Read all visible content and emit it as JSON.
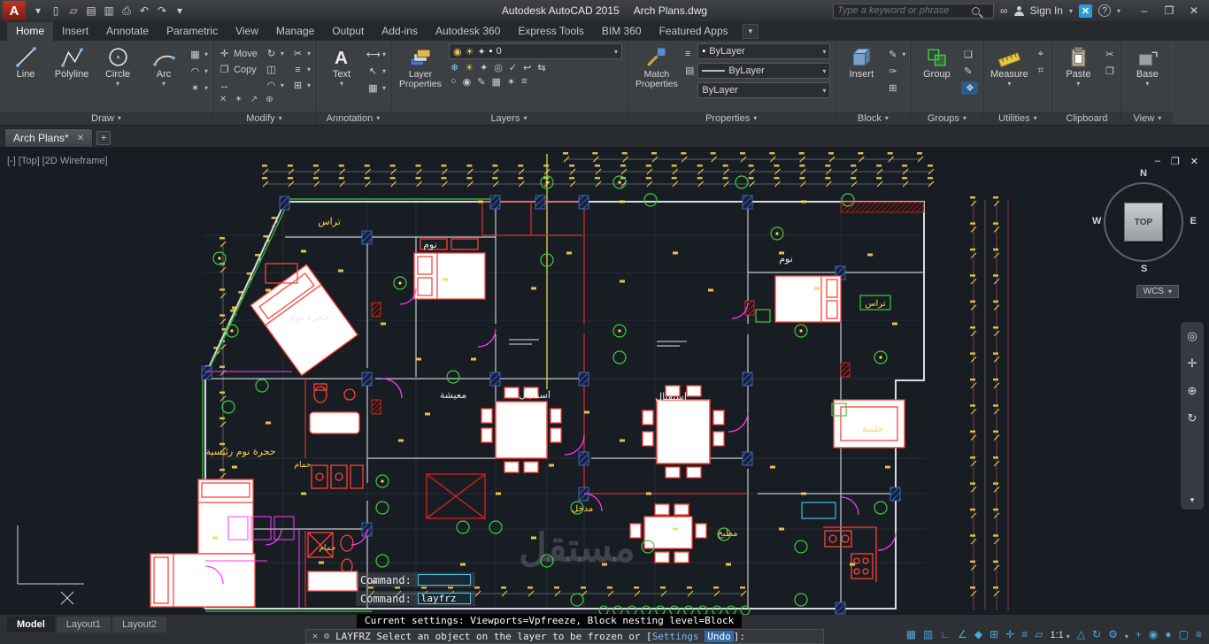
{
  "colors": {
    "background": "#181d23",
    "wall": "#d8dce0",
    "furniture_red": "#ff4038",
    "dimension_yellow": "#ffd34d",
    "door_magenta": "#ff3bff",
    "grid_green": "#3ecb3e",
    "hatch_blue": "#4f74d8",
    "status_teal": "#4aa8dc",
    "logo_red": "#b42a22"
  },
  "icons": {
    "logo_a": "A",
    "text_a": "A",
    "new": "▯",
    "open": "▱",
    "save": "▤",
    "saveas": "▥",
    "plot": "⎙",
    "undo": "↶",
    "redo": "↷",
    "caret": "▾",
    "binoculars": "∞",
    "star": "★",
    "exchange": "✕",
    "help": "?",
    "minimize": "–",
    "maximize": "❐",
    "close": "✕",
    "plus": "+",
    "rotate": "↻",
    "mirror": "◫",
    "fillet": "◠",
    "trim": "✂",
    "offset": "≡",
    "array": "⊞",
    "erase": "✕",
    "explode": "✶",
    "stretch": "↔",
    "scale": "↗",
    "join": "⊕",
    "dim": "⟷",
    "leader": "↖",
    "table": "▦",
    "freeze": "❄",
    "sun": "☀",
    "lock": "✦",
    "isolate": "◎",
    "match": "✓",
    "prev": "↩",
    "merge": "⇆",
    "off": "○",
    "on": "◉",
    "edit": "✎",
    "attrib": "✑",
    "blockdef": "⊞",
    "id": "⌖",
    "quickcalc": "⌗",
    "cut": "✂",
    "copyclip": "❐",
    "group_more": "❏",
    "group_sel": "❖",
    "wheel": "◎",
    "pan": "✛",
    "zoom": "⊕",
    "orbit": "↻",
    "swatch": "▪",
    "bulb": "◉",
    "hatch": "▦",
    "region": "✶",
    "gear": "⚙",
    "cmd_close": "✕"
  },
  "titlebar": {
    "app_title": "Autodesk AutoCAD 2015",
    "doc_title": "Arch Plans.dwg",
    "search_placeholder": "Type a keyword or phrase",
    "sign_in": "Sign In"
  },
  "ribbon": {
    "tabs": [
      {
        "label": "Home"
      },
      {
        "label": "Insert"
      },
      {
        "label": "Annotate"
      },
      {
        "label": "Parametric"
      },
      {
        "label": "View"
      },
      {
        "label": "Manage"
      },
      {
        "label": "Output"
      },
      {
        "label": "Add-ins"
      },
      {
        "label": "Autodesk 360"
      },
      {
        "label": "Express Tools"
      },
      {
        "label": "BIM 360"
      },
      {
        "label": "Featured Apps"
      }
    ],
    "panels": {
      "draw": {
        "label": "Draw",
        "line": "Line",
        "polyline": "Polyline",
        "circle": "Circle",
        "arc": "Arc"
      },
      "modify": {
        "label": "Modify",
        "move": "Move",
        "copy": "Copy"
      },
      "annotation": {
        "label": "Annotation",
        "text": "Text"
      },
      "layers": {
        "label": "Layers",
        "big": "Layer Properties",
        "layer_value": "0"
      },
      "properties": {
        "label": "Properties",
        "big": "Match Properties",
        "color": "ByLayer",
        "linetype": "ByLayer",
        "lineweight": "ByLayer"
      },
      "block": {
        "label": "Block",
        "big": "Insert"
      },
      "groups": {
        "label": "Groups",
        "big": "Group"
      },
      "utilities": {
        "label": "Utilities",
        "big": "Measure"
      },
      "clipboard": {
        "label": "Clipboard",
        "big": "Paste"
      },
      "view": {
        "label": "View",
        "big": "Base"
      }
    }
  },
  "doc_tabs": {
    "active": "Arch Plans*"
  },
  "viewport": {
    "controls": "[-]",
    "view": "[Top]",
    "visual_style": "[2D Wireframe]",
    "viewcube": {
      "n": "N",
      "s": "S",
      "e": "E",
      "w": "W",
      "face": "TOP",
      "wcs": "WCS"
    },
    "watermark": "مستقل"
  },
  "drawing": {
    "labels": [
      {
        "text": "تراس",
        "color": "#ffd34d"
      },
      {
        "text": "نوم",
        "color": "#e8eaec"
      },
      {
        "text": "حجرة نوم",
        "color": "#e8eaec"
      },
      {
        "text": "معيشة",
        "color": "#e8eaec"
      },
      {
        "text": "استقبال",
        "color": "#e8eaec"
      },
      {
        "text": "استقبال",
        "color": "#e8eaec"
      },
      {
        "text": "حجرة نوم رئيسية",
        "color": "#ffd34d"
      },
      {
        "text": "حمام",
        "color": "#ffd34d"
      },
      {
        "text": "حمام",
        "color": "#ffd34d"
      },
      {
        "text": "مدخل",
        "color": "#ffd34d"
      },
      {
        "text": "مطبخ",
        "color": "#ffd34d"
      },
      {
        "text": "تراس",
        "color": "#ffd34d"
      },
      {
        "text": "نوم",
        "color": "#e8eaec"
      },
      {
        "text": "جلسة",
        "color": "#ffd34d"
      }
    ]
  },
  "command": {
    "history1": "Command:",
    "history2": "Command:",
    "typed": "layfrz",
    "settings": "Current settings: Viewports=Vpfreeze, Block nesting level=Block",
    "prompt_prefix": "LAYFRZ Select an object on the layer to be frozen or [",
    "option_settings": "Settings",
    "option_undo": "Undo",
    "prompt_suffix": "]:"
  },
  "statusbar": {
    "model_tabs": [
      {
        "label": "Model"
      },
      {
        "label": "Layout1"
      },
      {
        "label": "Layout2"
      }
    ],
    "scale": "1:1",
    "icons_left": [
      {
        "name": "grid-icon",
        "glyph": "▦"
      },
      {
        "name": "snap-icon",
        "glyph": "▥"
      },
      {
        "name": "ortho-icon",
        "glyph": "∟"
      },
      {
        "name": "polar-icon",
        "glyph": "∠"
      },
      {
        "name": "isodraft-icon",
        "glyph": "◆"
      },
      {
        "name": "osnap-icon",
        "glyph": "⊞"
      },
      {
        "name": "otrack-icon",
        "glyph": "✛"
      },
      {
        "name": "lineweight-icon",
        "glyph": "≡"
      },
      {
        "name": "transparency-icon",
        "glyph": "▱"
      }
    ],
    "icons_right": [
      {
        "name": "annotation-visibility-icon",
        "glyph": "△"
      },
      {
        "name": "autoscale-icon",
        "glyph": "↻"
      },
      {
        "name": "workspace-gear-icon",
        "glyph": "⚙"
      },
      {
        "name": "annotation-monitor-icon",
        "glyph": "+"
      },
      {
        "name": "isolate-objects-icon",
        "glyph": "◉"
      },
      {
        "name": "graphics-performance-icon",
        "glyph": "●"
      },
      {
        "name": "clean-screen-icon",
        "glyph": "▢"
      },
      {
        "name": "customization-icon",
        "glyph": "≡"
      }
    ]
  }
}
